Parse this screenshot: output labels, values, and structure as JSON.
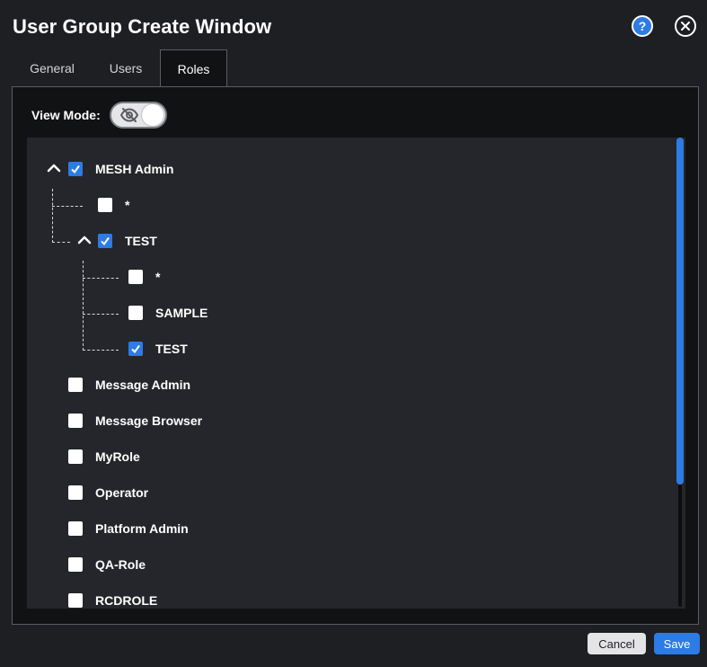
{
  "window": {
    "title": "User Group Create Window"
  },
  "header": {
    "help_icon": "question-circle-icon",
    "close_icon": "close-circle-icon",
    "help_glyph": "?"
  },
  "tabs": [
    {
      "label": "General",
      "active": false
    },
    {
      "label": "Users",
      "active": false
    },
    {
      "label": "Roles",
      "active": true
    }
  ],
  "view_mode": {
    "label": "View Mode:",
    "icon": "eye-slash-icon",
    "enabled": true
  },
  "tree": {
    "nodes": [
      {
        "label": "MESH Admin",
        "checked": true,
        "level": 0,
        "expanded": true
      },
      {
        "label": "*",
        "checked": false,
        "level": 1
      },
      {
        "label": "TEST",
        "checked": true,
        "level": 1,
        "expanded": true
      },
      {
        "label": "*",
        "checked": false,
        "level": 2
      },
      {
        "label": "SAMPLE",
        "checked": false,
        "level": 2
      },
      {
        "label": "TEST",
        "checked": true,
        "level": 2
      },
      {
        "label": "Message Admin",
        "checked": false,
        "level": 0
      },
      {
        "label": "Message Browser",
        "checked": false,
        "level": 0
      },
      {
        "label": "MyRole",
        "checked": false,
        "level": 0
      },
      {
        "label": "Operator",
        "checked": false,
        "level": 0
      },
      {
        "label": "Platform Admin",
        "checked": false,
        "level": 0
      },
      {
        "label": "QA-Role",
        "checked": false,
        "level": 0
      },
      {
        "label": "RCDROLE",
        "checked": false,
        "level": 0
      }
    ]
  },
  "footer": {
    "cancel_label": "Cancel",
    "save_label": "Save"
  },
  "colors": {
    "accent": "#2d7be5",
    "background": "#1e1f23",
    "panel": "#111214",
    "tree_bg": "#25262b"
  }
}
